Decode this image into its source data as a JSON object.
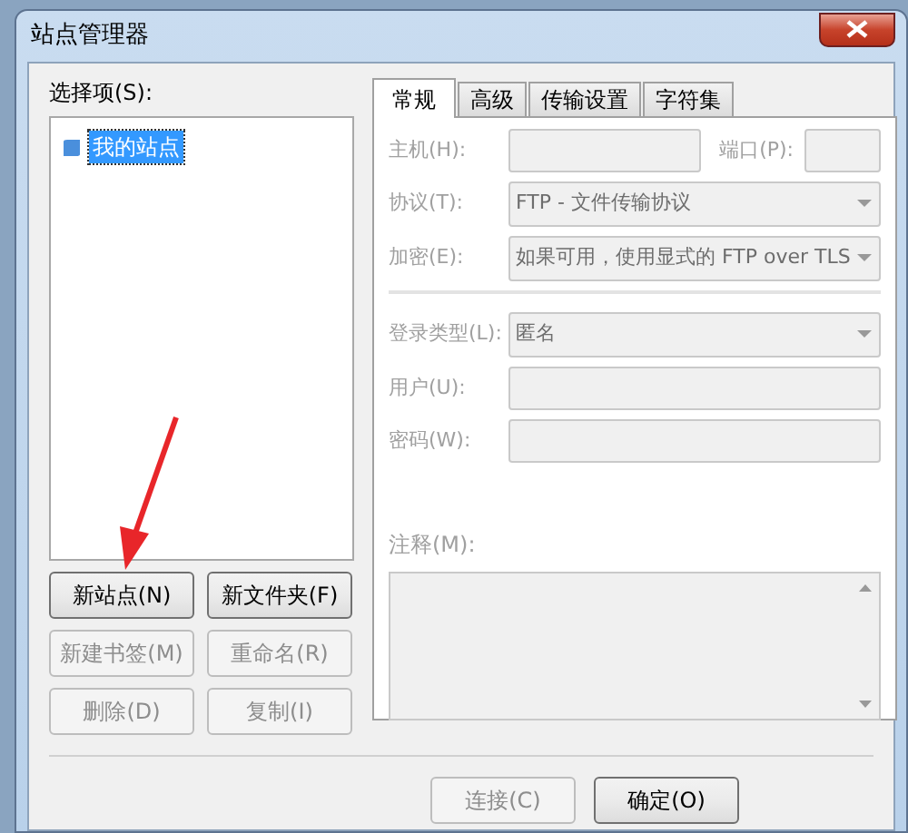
{
  "window": {
    "title": "站点管理器"
  },
  "select_label": "选择项(S):",
  "tree": [
    {
      "label": "我的站点",
      "selected": true
    }
  ],
  "tree_buttons": [
    {
      "label": "新站点(N)",
      "disabled": false
    },
    {
      "label": "新文件夹(F)",
      "disabled": false
    },
    {
      "label": "新建书签(M)",
      "disabled": true
    },
    {
      "label": "重命名(R)",
      "disabled": true
    },
    {
      "label": "删除(D)",
      "disabled": true
    },
    {
      "label": "复制(I)",
      "disabled": true
    }
  ],
  "tabs": [
    {
      "label": "常规",
      "selected": true
    },
    {
      "label": "高级",
      "selected": false
    },
    {
      "label": "传输设置",
      "selected": false
    },
    {
      "label": "字符集",
      "selected": false
    }
  ],
  "fields": [
    {
      "kind": "host",
      "label": "主机(H):",
      "port_label": "端口(P):",
      "disabled": true
    },
    {
      "kind": "select",
      "label": "协议(T):",
      "value": "FTP - 文件传输协议",
      "disabled": true
    },
    {
      "kind": "select",
      "label": "加密(E):",
      "value": "如果可用，使用显式的 FTP over TLS",
      "disabled": true
    },
    {
      "kind": "separator"
    },
    {
      "kind": "select",
      "label": "登录类型(L):",
      "value": "匿名",
      "disabled": true
    },
    {
      "kind": "input",
      "label": "用户(U):",
      "disabled": true
    },
    {
      "kind": "input",
      "label": "密码(W):",
      "disabled": true
    }
  ],
  "comment": {
    "label": "注释(M):",
    "disabled": true
  },
  "buttons": [
    {
      "label": "连接(C)",
      "disabled": true
    },
    {
      "label": "确定(O)",
      "disabled": false
    }
  ]
}
